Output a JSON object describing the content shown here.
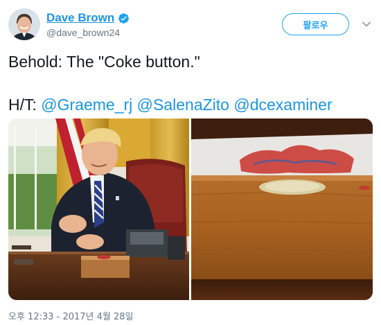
{
  "tweet": {
    "author": {
      "display_name": "Dave Brown",
      "handle": "@dave_brown24",
      "verified_icon": "verified-badge-icon",
      "avatar_icon": "profile-avatar"
    },
    "follow_label": "팔로우",
    "menu_icon": "chevron-down-icon",
    "text": {
      "line1": "Behold: The \"Coke button.\"",
      "ht_prefix": "H/T: ",
      "mentions": [
        "@Graeme_rj",
        "@SalenaZito",
        "@dcexaminer"
      ]
    },
    "media": {
      "count": 2,
      "left_photo": "photo-president-at-desk",
      "right_photo": "photo-desk-button-box"
    },
    "timestamp": "오후 12:33 - 2017년 4월 28일"
  },
  "colors": {
    "link": "#1b95e0",
    "follow_border": "#1da1f2",
    "secondary_text": "#657786",
    "primary_text": "#14171a"
  }
}
